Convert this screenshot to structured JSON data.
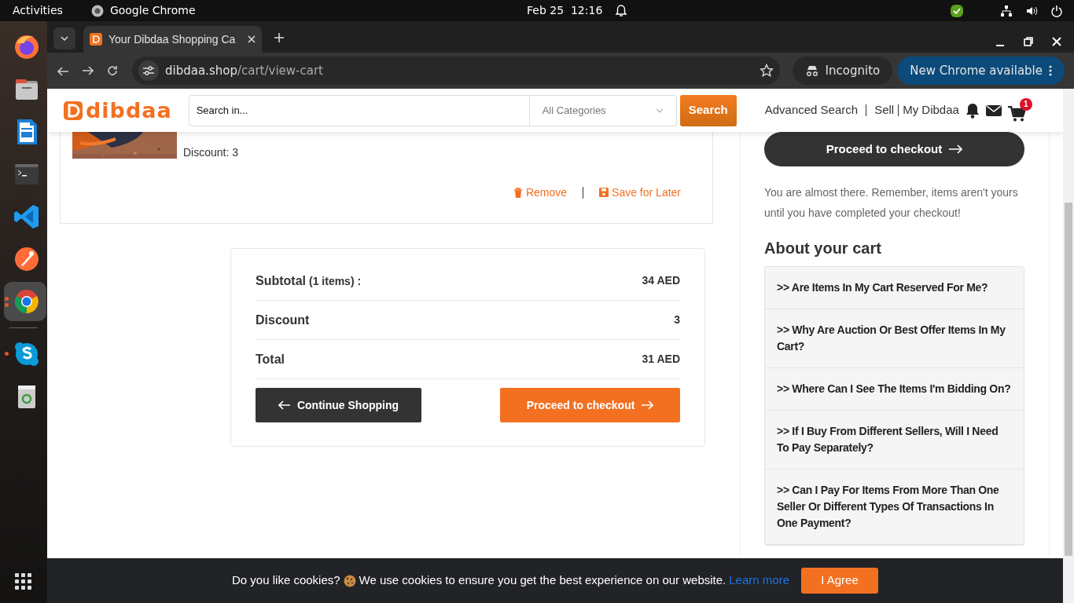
{
  "topbar": {
    "activities": "Activities",
    "app": "Google Chrome",
    "clock": "Feb 25  12:16"
  },
  "dock": [
    {
      "items": [
        {
          "kind": "firefox",
          "running": false,
          "selected": false
        },
        {
          "kind": "files",
          "running": false,
          "selected": false
        },
        {
          "kind": "writer",
          "running": false,
          "selected": false
        },
        {
          "kind": "terminal",
          "running": false,
          "selected": false
        },
        {
          "kind": "vscode",
          "running": false,
          "selected": false
        },
        {
          "kind": "postman",
          "running": false,
          "selected": false
        },
        {
          "kind": "chrome",
          "running": true,
          "selected": true
        }
      ]
    },
    {
      "items": [
        {
          "kind": "skype",
          "running": true,
          "selected": false
        },
        {
          "kind": "trash",
          "running": false,
          "selected": false
        }
      ]
    }
  ],
  "browser": {
    "tab_title": "Your Dibdaa Shopping Ca",
    "url_host": "dibdaa.shop",
    "url_path": "/cart/view-cart",
    "incognito": "Incognito",
    "update": "New Chrome available"
  },
  "header": {
    "logo": "dibdaa",
    "search_placeholder": "Search in...",
    "category": "All Categories",
    "search_button": "Search",
    "links": [
      "Advanced Search",
      "Sell",
      "My Dibdaa"
    ],
    "cart_count": "1"
  },
  "cart_item": {
    "discount": "Discount: 3",
    "actions": [
      {
        "kind": "remove",
        "label": "Remove"
      },
      {
        "kind": "save",
        "label": "Save for Later"
      }
    ]
  },
  "summary": {
    "rows": [
      {
        "label": "Subtotal",
        "note": "(1 items) :",
        "value": "34 AED"
      },
      {
        "label": "Discount",
        "value": "3"
      },
      {
        "label": "Total",
        "value": "31 AED"
      }
    ],
    "continue": "Continue Shopping",
    "proceed": "Proceed to checkout"
  },
  "sidebar": {
    "checkout": "Proceed to checkout",
    "note": "You are almost there. Remember, items aren't yours until you have completed your checkout!",
    "heading": "About your cart",
    "faqs": [
      ">> Are Items In My Cart Reserved For Me?",
      ">> Why Are Auction Or Best Offer Items In My Cart?",
      ">> Where Can I See The Items I'm Bidding On?",
      ">> If I Buy From Different Sellers, Will I Need To Pay Separately?",
      ">> Can I Pay For Items From More Than One Seller Or Different Types Of Transactions In One Payment?"
    ]
  },
  "cookie": {
    "before": "Do you like cookies?",
    "after": "We use cookies to ensure you get the best experience on our website.",
    "link": "Learn more",
    "button": "I Agree"
  }
}
